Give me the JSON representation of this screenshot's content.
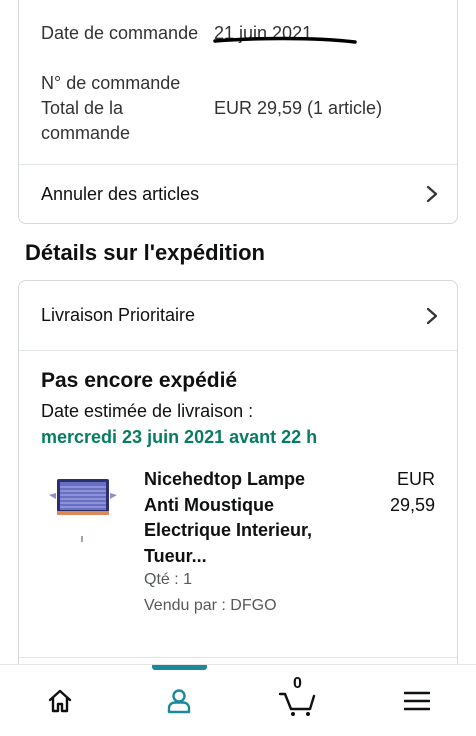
{
  "order_summary": {
    "date_label": "Date de commande",
    "date_value": "21 juin 2021",
    "number_label": "N° de commande",
    "number_value": "",
    "total_label": "Total de la commande",
    "total_value": "EUR 29,59 (1 article)",
    "cancel_label": "Annuler des articles"
  },
  "shipping": {
    "section_title": "Détails sur l'expédition",
    "method_label": "Livraison Prioritaire",
    "status": "Pas encore expédié",
    "eta_label": "Date estimée de livraison :",
    "eta_value": "mercredi 23 juin 2021 avant 22 h",
    "item": {
      "title": "Nicehedtop Lampe Anti Moustique Electrique Interieur, Tueur...",
      "price_currency": "EUR",
      "price_amount": "29,59",
      "quantity": "Qté : 1",
      "seller": "Vendu par : DFGO"
    }
  },
  "bottom_nav": {
    "items": [
      {
        "icon": "home-icon"
      },
      {
        "icon": "account-icon",
        "active": true
      },
      {
        "icon": "cart-icon",
        "count": "0"
      },
      {
        "icon": "menu-icon"
      }
    ]
  },
  "colors": {
    "accent": "#067d62",
    "active_tab": "#1a8a9a",
    "border": "#d5d9d9"
  }
}
